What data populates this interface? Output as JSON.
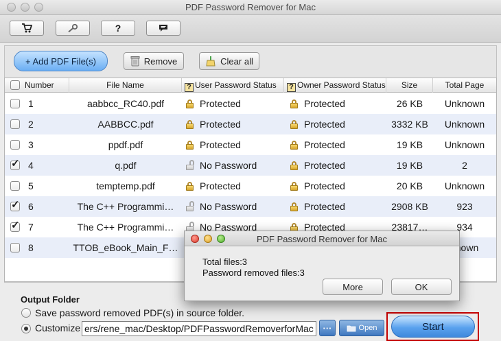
{
  "window": {
    "title": "PDF Password Remover for Mac"
  },
  "toolbar": {
    "cart_icon": "cart-icon",
    "key_icon": "key-icon",
    "help_label": "?",
    "chat_icon": "chat-icon"
  },
  "actions": {
    "add_label": "+ Add PDF File(s)",
    "remove_label": "Remove",
    "clear_label": "Clear all"
  },
  "table": {
    "headers": {
      "number": "Number",
      "file_name": "File Name",
      "user_status": "User Password Status",
      "owner_status": "Owner Password Status",
      "size": "Size",
      "total_page": "Total Page"
    },
    "rows": [
      {
        "checked": false,
        "number": "1",
        "file_name": "aabbcc_RC40.pdf",
        "user_status": "Protected",
        "owner_status": "Protected",
        "size": "26 KB",
        "total_page": "Unknown"
      },
      {
        "checked": false,
        "number": "2",
        "file_name": "AABBCC.pdf",
        "user_status": "Protected",
        "owner_status": "Protected",
        "size": "3332 KB",
        "total_page": "Unknown"
      },
      {
        "checked": false,
        "number": "3",
        "file_name": "ppdf.pdf",
        "user_status": "Protected",
        "owner_status": "Protected",
        "size": "19 KB",
        "total_page": "Unknown"
      },
      {
        "checked": true,
        "number": "4",
        "file_name": "q.pdf",
        "user_status": "No Password",
        "owner_status": "Protected",
        "size": "19 KB",
        "total_page": "2"
      },
      {
        "checked": false,
        "number": "5",
        "file_name": "temptemp.pdf",
        "user_status": "Protected",
        "owner_status": "Protected",
        "size": "20 KB",
        "total_page": "Unknown"
      },
      {
        "checked": true,
        "number": "6",
        "file_name": "The C++ Programmi…",
        "user_status": "No Password",
        "owner_status": "Protected",
        "size": "2908 KB",
        "total_page": "923"
      },
      {
        "checked": true,
        "number": "7",
        "file_name": "The C++ Programmi…",
        "user_status": "No Password",
        "owner_status": "Protected",
        "size": "23817…",
        "total_page": "934"
      },
      {
        "checked": false,
        "number": "8",
        "file_name": "TTOB_eBook_Main_F…",
        "user_status": "",
        "owner_status": "",
        "size": "",
        "total_page": "known"
      }
    ]
  },
  "output": {
    "label": "Output Folder",
    "option_source": "Save password removed PDF(s) in source folder.",
    "option_custom": "Customize",
    "path_value": "ers/rene_mac/Desktop/PDFPasswordRemoverforMac",
    "browse_label": "···",
    "open_label": "Open",
    "start_label": "Start"
  },
  "dialog": {
    "title": "PDF Password Remover for Mac",
    "total_files": "Total files:3",
    "removed_files": "Password removed files:3",
    "more_label": "More",
    "ok_label": "OK"
  }
}
